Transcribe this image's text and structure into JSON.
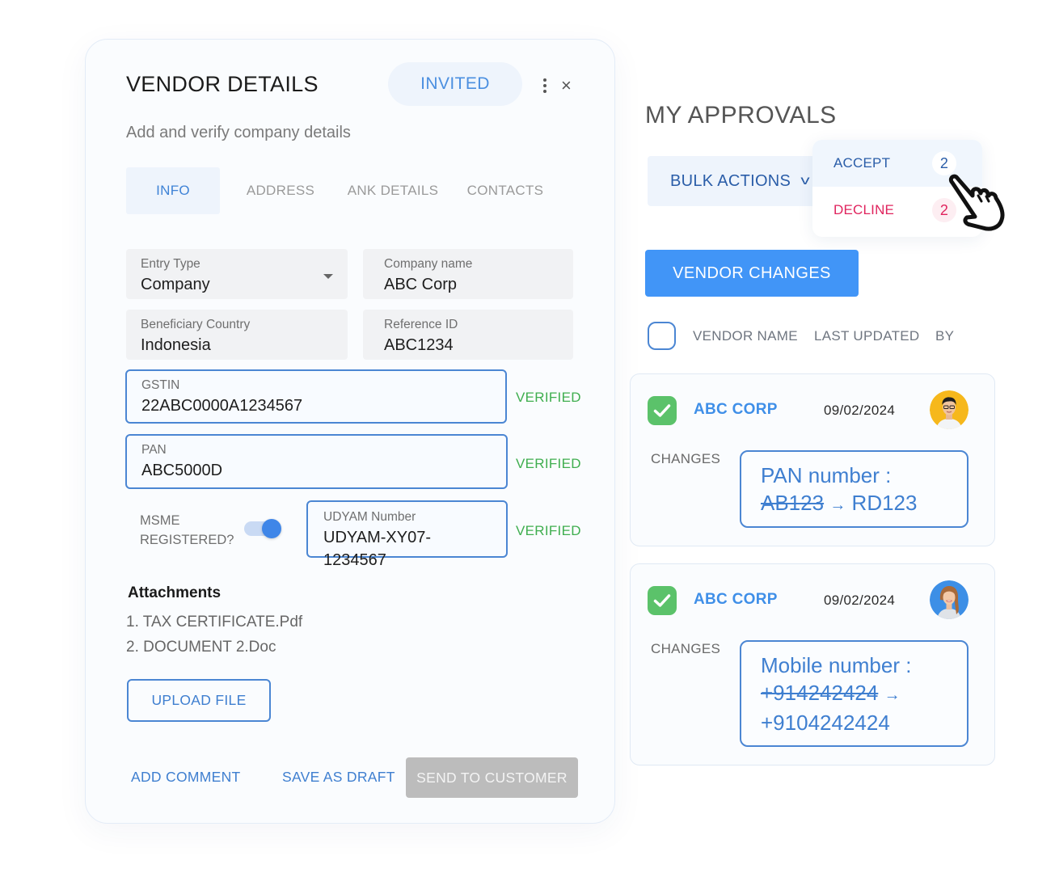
{
  "vendor_panel": {
    "title": "VENDOR DETAILS",
    "status": "INVITED",
    "close_icon": "×",
    "subtitle": "Add and verify company details",
    "tabs": [
      {
        "label": "INFO",
        "active": true
      },
      {
        "label": "ADDRESS",
        "active": false
      },
      {
        "label": "ANK DETAILS",
        "active": false
      },
      {
        "label": "CONTACTS",
        "active": false
      }
    ],
    "fields": {
      "entry_type": {
        "label": "Entry Type",
        "value": "Company"
      },
      "company_name": {
        "label": "Company name",
        "value": "ABC Corp"
      },
      "beneficiary_country": {
        "label": "Beneficiary Country",
        "value": "Indonesia"
      },
      "reference_id": {
        "label": "Reference ID",
        "value": "ABC1234"
      },
      "gstin": {
        "label": "GSTIN",
        "value": "22ABC0000A1234567",
        "status": "VERIFIED"
      },
      "pan": {
        "label": "PAN",
        "value": "ABC5000D",
        "status": "VERIFIED"
      },
      "udyam": {
        "label": "UDYAM Number",
        "value": "UDYAM-XY07-1234567",
        "status": "VERIFIED"
      }
    },
    "msme": {
      "label_line1": "MSME",
      "label_line2": "REGISTERED?",
      "enabled": true
    },
    "attachments": {
      "title": "Attachments",
      "items": [
        "1. TAX CERTIFICATE.Pdf",
        "2. DOCUMENT 2.Doc"
      ]
    },
    "upload_label": "UPLOAD FILE",
    "footer": {
      "add_comment": "ADD COMMENT",
      "save_draft": "SAVE AS DRAFT",
      "send": "SEND TO CUSTOMER"
    }
  },
  "approvals": {
    "title": "MY APPROVALS",
    "bulk_actions": {
      "label": "BULK ACTIONS",
      "chevron": "v",
      "menu": [
        {
          "label": "ACCEPT",
          "count": "2"
        },
        {
          "label": "DECLINE",
          "count": "2"
        }
      ]
    },
    "tab_button": "VENDOR CHANGES",
    "columns": [
      "VENDOR NAME",
      "LAST UPDATED",
      "BY"
    ],
    "cards": [
      {
        "vendor": "ABC CORP",
        "date": "09/02/2024",
        "changes_label": "CHANGES",
        "field": "PAN number :",
        "old_value": "AB123",
        "arrow": "→",
        "new_value": "RD123",
        "avatar": "male-avatar"
      },
      {
        "vendor": "ABC CORP",
        "date": "09/02/2024",
        "changes_label": "CHANGES",
        "field": "Mobile number :",
        "old_value": "+914242424",
        "arrow": "→",
        "new_value": "+9104242424",
        "avatar": "female-avatar"
      }
    ]
  },
  "colors": {
    "accent_blue": "#4195f7",
    "link_blue": "#3f7fd0",
    "verified_green": "#3fae4f",
    "decline_red": "#e0245e",
    "disabled_gray": "#bcbcbc"
  }
}
